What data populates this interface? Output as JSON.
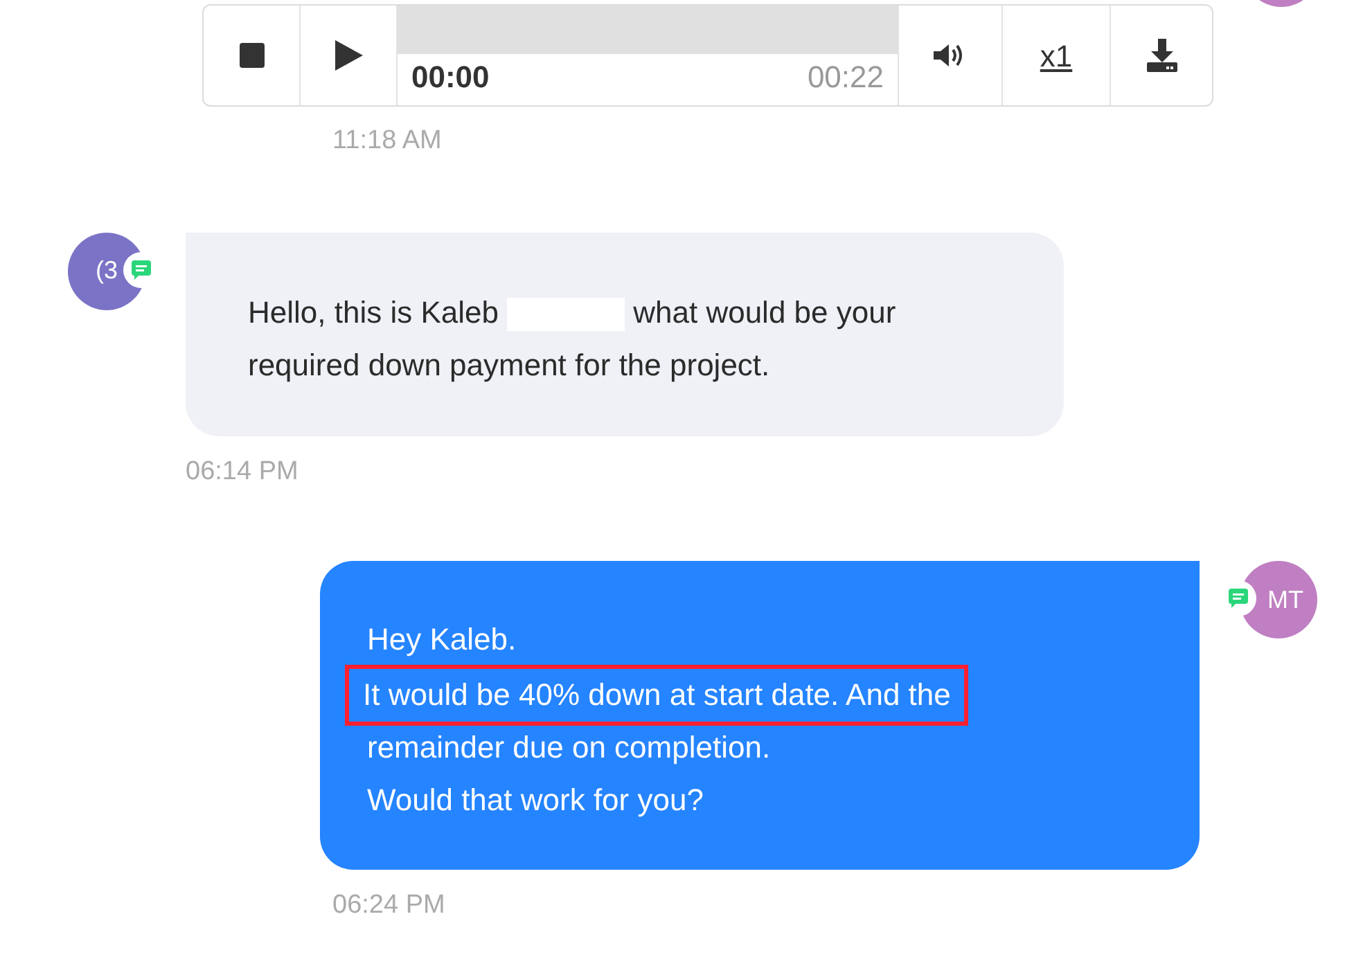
{
  "audio_player": {
    "current_time": "00:00",
    "duration": "00:22",
    "level": 0,
    "speed": "x1",
    "time": "11:18 AM"
  },
  "messages": [
    {
      "kind": "incoming",
      "avatar": "(3",
      "text_before": "Hello, this is Kaleb",
      "redacted": true,
      "text_after": "what would be your required down payment for the project.",
      "time": "06:14 PM"
    },
    {
      "kind": "outgoing",
      "avatar": "MT",
      "lines": [
        {
          "text": "Hey Kaleb.",
          "highlighted": false
        },
        {
          "text": "It would be 40% down at start date. And the",
          "highlighted": true
        },
        {
          "text": "remainder due on completion.",
          "highlighted": false
        },
        {
          "text": "Would that work for you?",
          "highlighted": false
        }
      ],
      "time": "06:24 PM"
    }
  ]
}
